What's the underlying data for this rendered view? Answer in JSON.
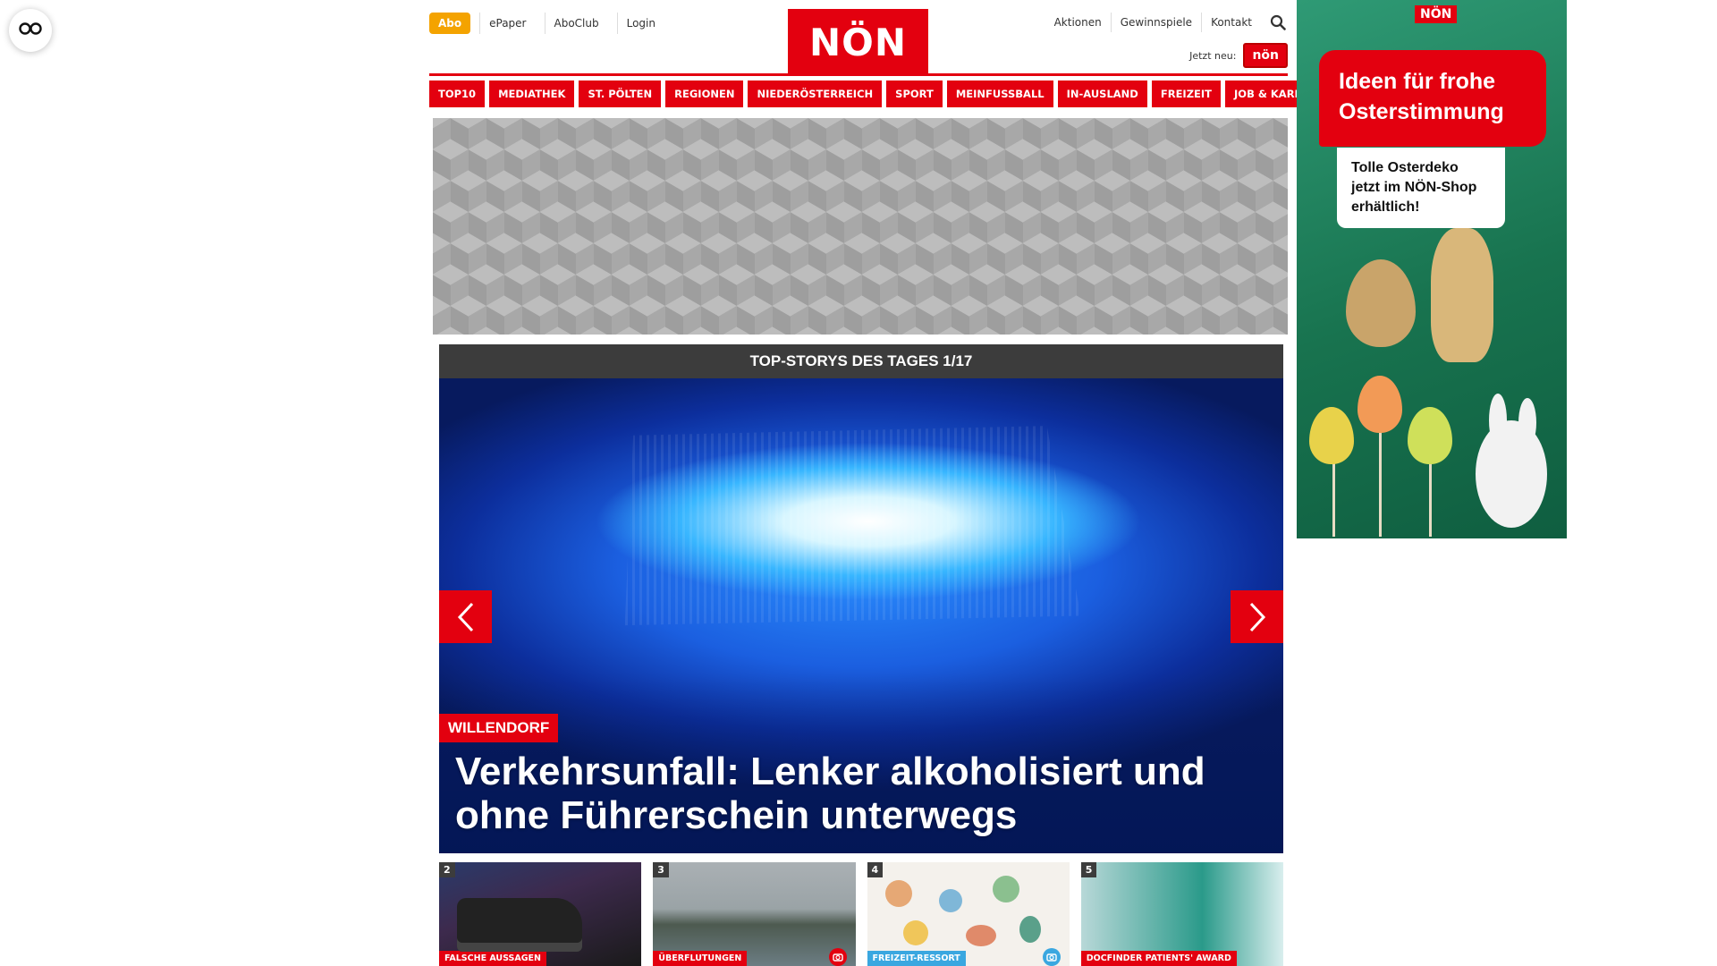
{
  "colors": {
    "brand_red": "#e3000f",
    "abo_orange": "#f4a300",
    "header_dark": "#3c3c3c"
  },
  "reader": {
    "icon": "glasses-icon"
  },
  "utility": {
    "abo": "Abo",
    "links": [
      "ePaper",
      "AboClub",
      "Login"
    ],
    "right_links": [
      "Aktionen",
      "Gewinnspiele",
      "Kontakt"
    ],
    "search_icon": "search-icon",
    "jetzt_neu": "Jetzt neu:",
    "jetzt_logo": "nön"
  },
  "logo": "NÖN",
  "nav": [
    "TOP10",
    "MEDIATHEK",
    "ST. PÖLTEN",
    "REGIONEN",
    "NIEDERÖSTERREICH",
    "SPORT",
    "MEINFUSSBALL",
    "IN-AUSLAND",
    "FREIZEIT",
    "JOB & KARRIERE"
  ],
  "stories": {
    "header": "TOP-STORYS DES TAGES 1/17",
    "hero": {
      "location": "WILLENDORF",
      "title": "Verkehrsunfall: Lenker alkoholisiert und ohne Führerschein unterwegs"
    },
    "thumbs": [
      {
        "num": "2",
        "label": "FALSCHE AUSSAGEN",
        "camera": false
      },
      {
        "num": "3",
        "label": "ÜBERFLUTUNGEN",
        "camera": true
      },
      {
        "num": "4",
        "label": "FREIZEIT-RESSORT",
        "camera": true
      },
      {
        "num": "5",
        "label": "DOCFINDER PATIENTS' AWARD",
        "camera": false
      }
    ]
  },
  "ad": {
    "logo": "NÖN",
    "headline": "Ideen für frohe Osterstimmung",
    "sub": "Tolle Osterdeko jetzt im NÖN-Shop erhältlich!"
  }
}
